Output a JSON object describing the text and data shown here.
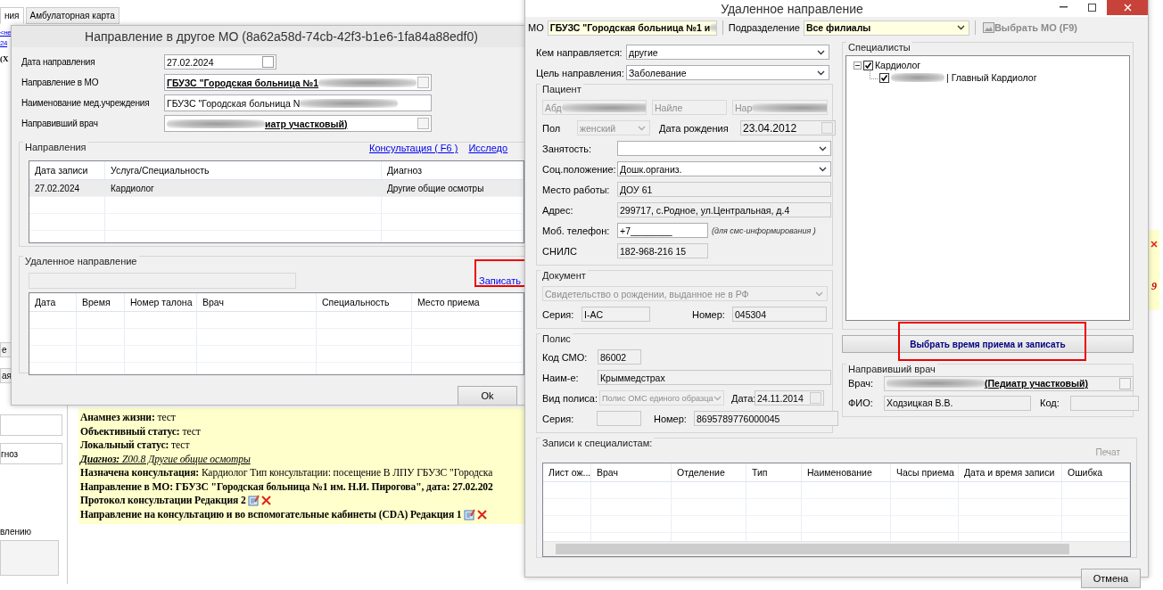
{
  "background_app": {
    "tabs": [
      {
        "label": "ния",
        "selected": true
      },
      {
        "label": "Амбулаторная карта",
        "selected": false
      }
    ],
    "side_links": [
      "<не",
      "24"
    ],
    "side_bold": "(Х",
    "lower_tabs": [
      "е",
      "ая"
    ],
    "side_field": "гноз",
    "side_text": "влению",
    "right_strip_text": "9",
    "document_lines": [
      {
        "kind": "field",
        "text": "**Анамнез жизни:** тест",
        "actions": false
      },
      {
        "kind": "field",
        "text": "**Объективный статус:** тест",
        "actions": false
      },
      {
        "kind": "field",
        "text": "**Локальный статус:** тест",
        "actions": false
      },
      {
        "kind": "diagnosis",
        "text": "**Диагноз:** Z00.8 Другие общие осмотры",
        "actions": false
      },
      {
        "kind": "field",
        "text": "**Назначена консультация:** Кардиолог Тип консультации: посещение В ЛПУ ГБУЗС \"Городска"
      },
      {
        "kind": "heading",
        "text": "Направление в МО: ГБУЗС \"Городская больница №1 им. Н.И. Пирогова\", дата: 27.02.202"
      },
      {
        "kind": "heading",
        "text": "Протокол консультации Редакция 2",
        "actions": true
      },
      {
        "kind": "heading",
        "text": "Направление на консультацию и во вспомогательные кабинеты (CDA) Редакция 1",
        "actions": true
      }
    ]
  },
  "referral_dialog": {
    "title": "Направление в другое МО (8a62a58d-74cb-42f3-b1e6-1fa84a88edf0)",
    "fields": [
      {
        "label": "Дата направления",
        "value": "27.02.2024",
        "kind": "date",
        "checked": false
      },
      {
        "label": "Направление в МО",
        "value": "ГБУЗС \"Городская больница №1",
        "kind": "lookup",
        "blur_after": true
      },
      {
        "label": "Наименование мед.учреждения",
        "value": "ГБУЗС \"Городская больница N",
        "kind": "text",
        "blur_after": true
      },
      {
        "label": "Направивший врач",
        "value": "иатр участковый)",
        "kind": "lookup",
        "blur_before": true
      }
    ],
    "directions": {
      "title": "Направления",
      "links": [
        "Консультация ( F6 )",
        "Исследо"
      ],
      "columns": [
        "Дата записи",
        "Услуга/Специальность",
        "Диагноз"
      ],
      "rows": [
        {
          "cells": [
            "27.02.2024",
            "Кардиолог",
            "Другие общие осмотры"
          ],
          "selected": true
        }
      ]
    },
    "remote": {
      "title": "Удаленное направление",
      "link": "Записать",
      "columns": [
        "Дата",
        "Время",
        "Номер талона",
        "Врач",
        "Специальность",
        "Место приема"
      ]
    },
    "ok_button": "Ok"
  },
  "remote_dialog": {
    "title": "Удаленное направление",
    "toolbar": {
      "mo_label": "МО",
      "mo_value": "ГБУЗС \"Городская больница №1 и",
      "subdivision_label": "Подразделение",
      "subdivision_value": "Все филиалы",
      "select_mo": "Выбрать МО (F9)",
      "select_mo_disabled": true
    },
    "top_rows": [
      {
        "label": "Кем направляется:",
        "value": "другие"
      },
      {
        "label": "Цель направления:",
        "value": "Заболевание"
      }
    ],
    "patient": {
      "title": "Пациент",
      "names": [
        {
          "value": "Абд",
          "blur_after": true,
          "disabled": true
        },
        {
          "value": "Найле",
          "disabled": true
        },
        {
          "value": "Нар",
          "blur_after": true,
          "disabled": true
        }
      ],
      "sex_label": "Пол",
      "sex_value": "женский",
      "sex_disabled": true,
      "birth_label": "Дата рождения",
      "birth_value": "23.04.2012",
      "rows": [
        {
          "kind": "select",
          "label": "Занятость:"
        },
        {
          "kind": "select",
          "label": "Соц.положение:",
          "value": "Дошк.организ."
        },
        {
          "kind": "text",
          "label": "Место работы:",
          "value": "ДОУ 61"
        },
        {
          "kind": "text",
          "label": "Адрес:",
          "value": "299717, с.Родное, ул.Центральная, д.4"
        },
        {
          "kind": "phone",
          "label": "Моб. телефон:",
          "value": "+7________",
          "hint": "(для смс-информирования )"
        },
        {
          "kind": "short",
          "label": "СНИЛС",
          "value": "182-968-216 15"
        }
      ]
    },
    "document": {
      "title": "Документ",
      "type": "Свидетельство о рождении, выданное не в РФ",
      "type_disabled": true,
      "series_label": "Серия:",
      "series": "I-AC",
      "number_label": "Номер:",
      "number": "045304"
    },
    "policy": {
      "title": "Полис",
      "smo_label": "Код СМО:",
      "smo": "86002",
      "name_label": "Наим-е:",
      "name": "Крыммедстрах",
      "type_label": "Вид полиса:",
      "type": "Полис ОМС единого образца",
      "type_disabled": true,
      "date_label": "Дата:",
      "date": "24.11.2014",
      "series_label": "Серия:",
      "number_label": "Номер:",
      "number": "8695789776000045"
    },
    "specialists": {
      "title": "Специалисты",
      "tree": [
        {
          "label": "Кардиолог",
          "checked": true,
          "expanded": true,
          "children": [
            {
              "label": "| Главный Кардиолог",
              "checked": true,
              "blur_before": true
            }
          ]
        }
      ]
    },
    "schedule_button": "Выбрать время приема и записать",
    "referring_doctor": {
      "title": "Направивший врач",
      "doctor_label": "Врач:",
      "doctor_value": "(Педиатр участковый)",
      "fio_label": "ФИО:",
      "fio": "Ходзицкая В.В.",
      "code_label": "Код:"
    },
    "appointments": {
      "title": "Записи к специалистам:",
      "print": "Печат",
      "columns": [
        "Лист ож...",
        "Врач",
        "Отделение",
        "Тип",
        "Наименование",
        "Часы приема",
        "Дата и время записи",
        "Ошибка"
      ]
    },
    "cancel_button": "Отмена"
  }
}
